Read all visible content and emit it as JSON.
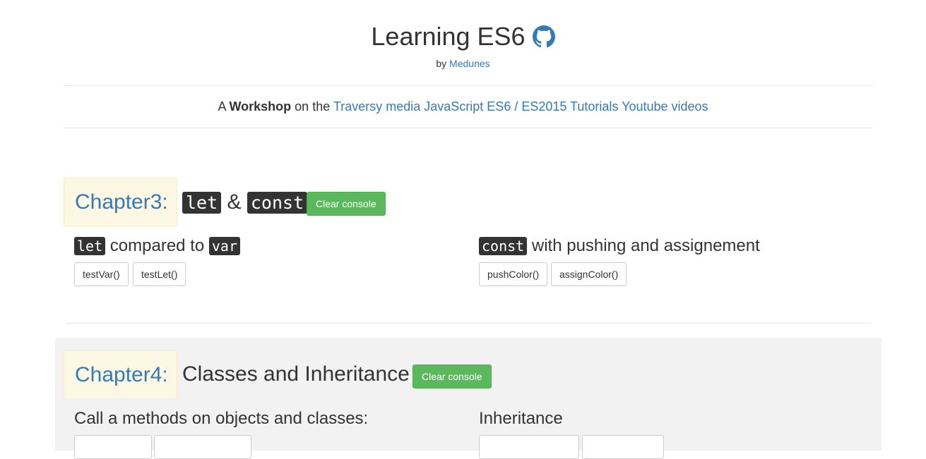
{
  "header": {
    "title": "Learning ES6",
    "by_prefix": "by",
    "author": "Medunes",
    "tagline_prefix": "A",
    "tagline_bold": "Workshop",
    "tagline_mid": "on the",
    "tagline_link": "Traversy media JavaScript ES6 / ES2015 Tutorials Youtube videos"
  },
  "chapter3": {
    "badge": "Chapter3:",
    "code_let": "let",
    "amp": "&",
    "code_const": "const",
    "clear_button": "Clear console",
    "left": {
      "code_let": "let",
      "text": "compared to",
      "code_var": "var",
      "buttons": [
        "testVar()",
        "testLet()"
      ]
    },
    "right": {
      "code_const": "const",
      "text": "with pushing and assignement",
      "buttons": [
        "pushColor()",
        "assignColor()"
      ]
    }
  },
  "chapter4": {
    "badge": "Chapter4:",
    "title": "Classes and Inheritance",
    "clear_button": "Clear console",
    "left_title": "Call a methods on objects and classes:",
    "right_title": "Inheritance"
  },
  "colors": {
    "link": "#337ab7",
    "success": "#5cb85c",
    "badge_bg": "#fcf8e3",
    "band_bg": "#f2f2f2"
  }
}
